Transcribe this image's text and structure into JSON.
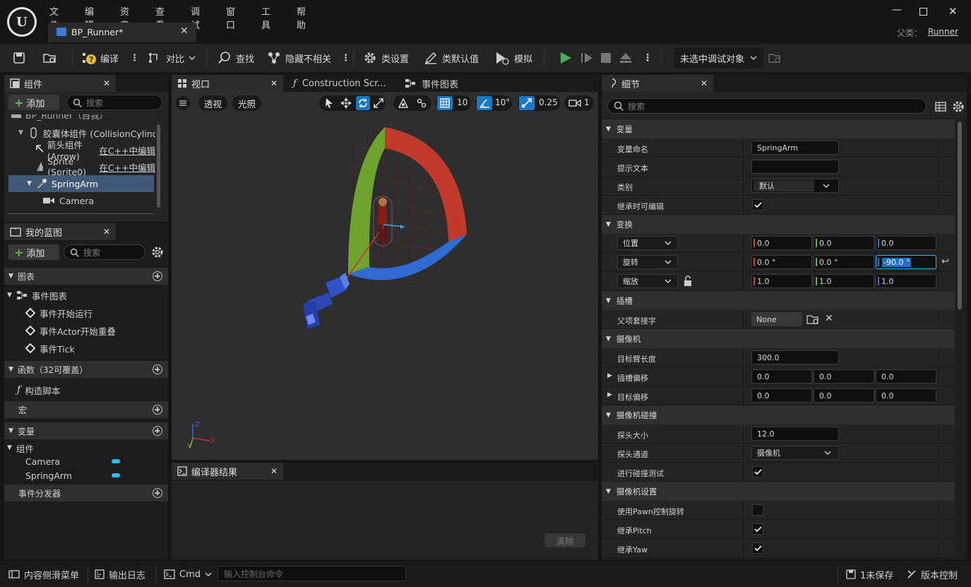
{
  "menu": [
    "文件",
    "编辑",
    "资产",
    "查看",
    "调试",
    "窗口",
    "工具",
    "帮助"
  ],
  "document_tab": "BP_Runner*",
  "parent_label": "父类：",
  "parent_value": "Runner",
  "toolbar": {
    "compile": "编译",
    "diff": "对比",
    "find": "查找",
    "hide_unrelated": "隐藏不相关",
    "class_settings": "类设置",
    "class_defaults": "类默认值",
    "simulate": "模拟",
    "debug_target": "未选中调试对象"
  },
  "components_panel": {
    "title": "组件",
    "add": "添加",
    "search_placeholder": "搜索",
    "items": [
      {
        "label": "BP_Runner（自我）",
        "kind": "root"
      },
      {
        "label": "胶囊体组件 (CollisionCylinder)",
        "kind": "capsule"
      },
      {
        "label": "箭头组件 (Arrow)",
        "sub": "在C++中编辑"
      },
      {
        "label": "Sprite (Sprite0)",
        "sub": "在C++中编辑"
      },
      {
        "label": "SpringArm",
        "selected": true
      },
      {
        "label": "Camera"
      }
    ]
  },
  "blueprint_panel": {
    "title": "我的蓝图",
    "add": "添加",
    "search_placeholder": "搜索",
    "sections": {
      "graphs": "图表",
      "event_graph": "事件图表",
      "events": [
        "事件开始运行",
        "事件Actor开始重叠",
        "事件Tick"
      ],
      "functions": "函数（32可覆盖）",
      "construction": "构造脚本",
      "macros": "宏",
      "variables": "变量",
      "components": "组件",
      "component_vars": [
        "Camera",
        "SpringArm"
      ],
      "dispatchers": "事件分发器"
    },
    "accent": "#26bbff"
  },
  "tabs": [
    {
      "label": "视口"
    },
    {
      "label": "Construction Scr..."
    },
    {
      "label": "事件图表"
    }
  ],
  "viewport": {
    "perspective": "透视",
    "lighting": "光照",
    "grid_snap": "10",
    "rot_snap": "10°",
    "scale_snap": "0.25",
    "camera_speed": "1",
    "axis_x": "X",
    "axis_y": "Y",
    "axis_z": "Z"
  },
  "compiler": {
    "title": "编译器结果",
    "clear": "清除"
  },
  "details": {
    "title": "细节",
    "search_placeholder": "搜索",
    "variable": {
      "header": "变量",
      "name_label": "变量命名",
      "name_value": "SpringArm",
      "tooltip_label": "提示文本",
      "tooltip_value": "",
      "category_label": "类别",
      "category_value": "默认",
      "editable_label": "继承时可编辑",
      "editable": true
    },
    "transform": {
      "header": "变换",
      "location_label": "位置",
      "location": [
        "0.0",
        "0.0",
        "0.0"
      ],
      "rotation_label": "旋转",
      "rotation": [
        "0.0 °",
        "0.0 °",
        "-90.0 °"
      ],
      "scale_label": "缩放",
      "scale": [
        "1.0",
        "1.0",
        "1.0"
      ]
    },
    "socket": {
      "header": "插槽",
      "parent_label": "父项套接字",
      "parent_value": "None"
    },
    "camera": {
      "header": "摄像机",
      "arm_label": "目标臂长度",
      "arm_value": "300.0",
      "socket_offset_label": "插槽偏移",
      "socket_offset": [
        "0.0",
        "0.0",
        "0.0"
      ],
      "target_offset_label": "目标偏移",
      "target_offset": [
        "0.0",
        "0.0",
        "0.0"
      ]
    },
    "collision": {
      "header": "摄像机碰撞",
      "probe_size_label": "探头大小",
      "probe_size": "12.0",
      "probe_channel_label": "探头通道",
      "probe_channel": "摄像机",
      "do_test_label": "进行碰撞测试",
      "do_test": true
    },
    "camera_settings": {
      "header": "摄像机设置",
      "pawn_rot_label": "使用Pawn控制旋转",
      "pawn_rot": false,
      "inherit_pitch_label": "继承Pitch",
      "inherit_pitch": true,
      "inherit_yaw_label": "继承Yaw",
      "inherit_yaw": true
    }
  },
  "statusbar": {
    "content_drawer": "内容侧滑菜单",
    "output_log": "输出日志",
    "cmd": "Cmd",
    "cmd_placeholder": "输入控制台命令",
    "unsaved": "1未保存",
    "source_control": "版本控制"
  },
  "colors": {
    "x": "#e03a2a",
    "y": "#6fb52c",
    "z": "#2f6fd8",
    "accent": "#26bbff",
    "play": "#4caf50"
  }
}
